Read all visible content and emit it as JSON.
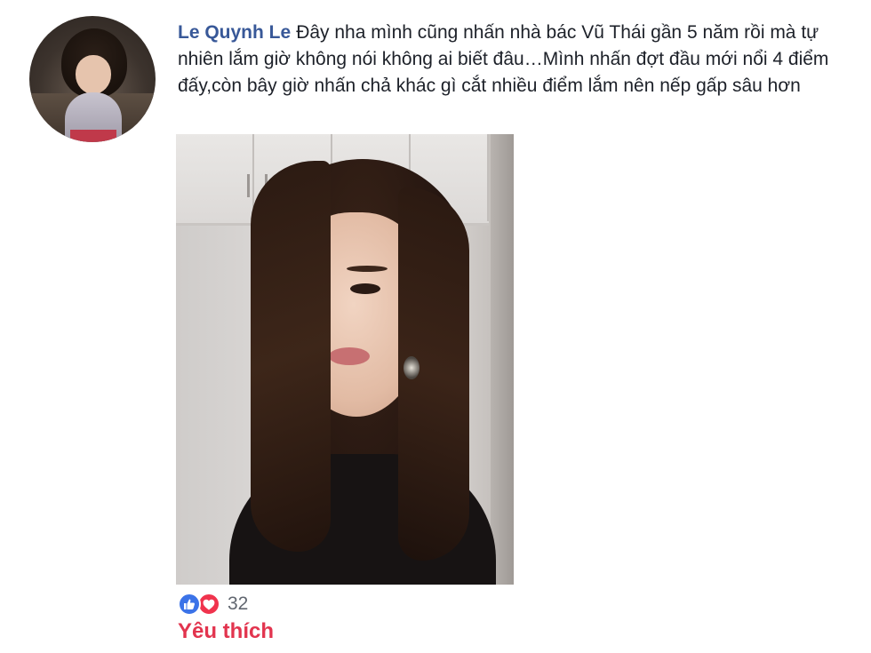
{
  "comment": {
    "author": "Le Quynh Le",
    "text": "Đây nha mình cũng nhấn nhà bác Vũ Thái gần 5 năm rồi mà tự nhiên lắm giờ không nói không ai biết đâu…Mình nhấn đợt đầu mới nổi 4 điểm đấy,còn bây giờ nhấn chả khác gì cắt nhiều điểm lắm nên nếp gấp sâu hơn"
  },
  "reactions": {
    "count": "32",
    "icons": [
      "like-icon",
      "love-icon"
    ],
    "colors": {
      "like": "#3b73e8",
      "love": "#f0334d"
    }
  },
  "actions": {
    "like_label": "Yêu thích",
    "like_color": "#e2344e"
  },
  "colors": {
    "author_name": "#385898",
    "body_text": "#1d2129"
  }
}
